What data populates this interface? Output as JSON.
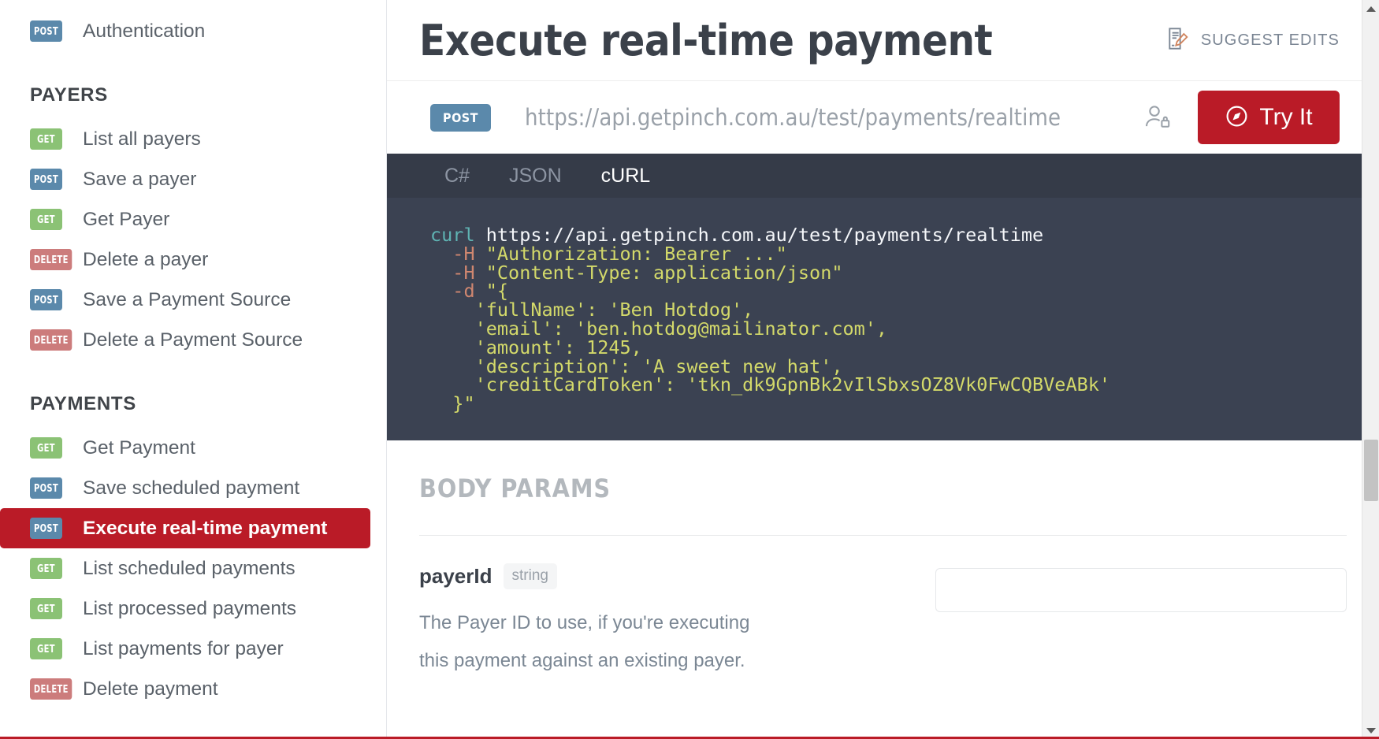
{
  "sidebar": {
    "top_items": [
      {
        "method": "POST",
        "label": "Authentication",
        "active": false
      }
    ],
    "groups": [
      {
        "title": "PAYERS",
        "items": [
          {
            "method": "GET",
            "label": "List all payers",
            "active": false
          },
          {
            "method": "POST",
            "label": "Save a payer",
            "active": false
          },
          {
            "method": "GET",
            "label": "Get Payer",
            "active": false
          },
          {
            "method": "DELETE",
            "label": "Delete a payer",
            "active": false
          },
          {
            "method": "POST",
            "label": "Save a Payment Source",
            "active": false
          },
          {
            "method": "DELETE",
            "label": "Delete a Payment Source",
            "active": false
          }
        ]
      },
      {
        "title": "PAYMENTS",
        "items": [
          {
            "method": "GET",
            "label": "Get Payment",
            "active": false
          },
          {
            "method": "POST",
            "label": "Save scheduled payment",
            "active": false
          },
          {
            "method": "POST",
            "label": "Execute real-time payment",
            "active": true
          },
          {
            "method": "GET",
            "label": "List scheduled payments",
            "active": false
          },
          {
            "method": "GET",
            "label": "List processed payments",
            "active": false
          },
          {
            "method": "GET",
            "label": "List payments for payer",
            "active": false
          },
          {
            "method": "DELETE",
            "label": "Delete payment",
            "active": false
          }
        ]
      }
    ]
  },
  "header": {
    "title": "Execute real-time payment",
    "suggest_edits_label": "SUGGEST EDITS",
    "suggest_edits_icon": "document-pencil-icon"
  },
  "url_bar": {
    "method": "POST",
    "url": "https://api.getpinch.com.au/test/payments/realtime",
    "auth_icon": "user-lock-icon",
    "try_it_label": "Try It",
    "try_it_icon": "compass-target-icon",
    "try_it_color": "#ba1b27"
  },
  "code": {
    "tabs": [
      {
        "label": "C#",
        "active": false
      },
      {
        "label": "JSON",
        "active": false
      },
      {
        "label": "cURL",
        "active": true
      }
    ],
    "lines": {
      "l1_cmd": "curl",
      "l1_url": "https://api.getpinch.com.au/test/payments/realtime",
      "l2_flag": "-H",
      "l2_str": "\"Authorization: Bearer ...\"",
      "l3_flag": "-H",
      "l3_str": "\"Content-Type: application/json\"",
      "l4_flag": "-d",
      "l4_str": "\"{",
      "l5": "'fullName': 'Ben Hotdog',",
      "l6": "'email': 'ben.hotdog@mailinator.com',",
      "l7": "'amount': 1245,",
      "l8": "'description': 'A sweet new hat',",
      "l9": "'creditCardToken': 'tkn_dk9GpnBk2vIlSbxsOZ8Vk0FwCQBVeABk'",
      "l10": "}\""
    }
  },
  "body_params": {
    "section_title": "BODY PARAMS",
    "params": [
      {
        "name": "payerId",
        "type": "string",
        "description": "The Payer ID to use, if you're executing this payment against an existing payer.",
        "value": "",
        "placeholder": ""
      }
    ]
  },
  "scrollbar": {
    "up_icon": "chevron-up-icon",
    "down_icon": "chevron-down-icon"
  }
}
